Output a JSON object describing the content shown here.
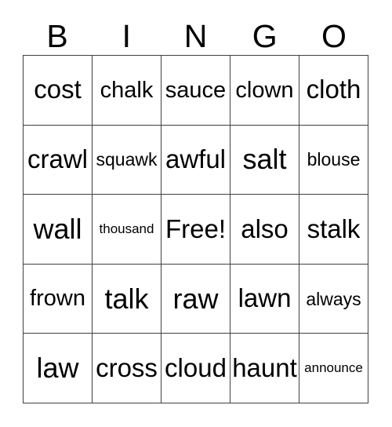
{
  "card": {
    "title": "BINGO Card",
    "header_letters": [
      "B",
      "I",
      "N",
      "G",
      "O"
    ],
    "columns": 5,
    "rows": 5,
    "border_color": "#404040",
    "background_color": "#ffffff",
    "text_color": "#000000"
  },
  "grid": {
    "rows": [
      {
        "cells": [
          {
            "text": "cost",
            "size": "fs-l"
          },
          {
            "text": "chalk",
            "size": "fs-m"
          },
          {
            "text": "sauce",
            "size": "fs-m"
          },
          {
            "text": "clown",
            "size": "fs-m"
          },
          {
            "text": "cloth",
            "size": "fs-l"
          }
        ]
      },
      {
        "cells": [
          {
            "text": "crawl",
            "size": "fs-l"
          },
          {
            "text": "squawk",
            "size": "fs-s"
          },
          {
            "text": "awful",
            "size": "fs-l"
          },
          {
            "text": "salt",
            "size": "fs-xl"
          },
          {
            "text": "blouse",
            "size": "fs-s"
          }
        ]
      },
      {
        "cells": [
          {
            "text": "wall",
            "size": "fs-xl"
          },
          {
            "text": "thousand",
            "size": "fs-xs"
          },
          {
            "text": "Free!",
            "size": "fs-l"
          },
          {
            "text": "also",
            "size": "fs-l"
          },
          {
            "text": "stalk",
            "size": "fs-l"
          }
        ]
      },
      {
        "cells": [
          {
            "text": "frown",
            "size": "fs-m"
          },
          {
            "text": "talk",
            "size": "fs-xl"
          },
          {
            "text": "raw",
            "size": "fs-xl"
          },
          {
            "text": "lawn",
            "size": "fs-l"
          },
          {
            "text": "always",
            "size": "fs-s"
          }
        ]
      },
      {
        "cells": [
          {
            "text": "law",
            "size": "fs-xl"
          },
          {
            "text": "cross",
            "size": "fs-l"
          },
          {
            "text": "cloud",
            "size": "fs-l"
          },
          {
            "text": "haunt",
            "size": "fs-l"
          },
          {
            "text": "announce",
            "size": "fs-xs"
          }
        ]
      }
    ]
  }
}
